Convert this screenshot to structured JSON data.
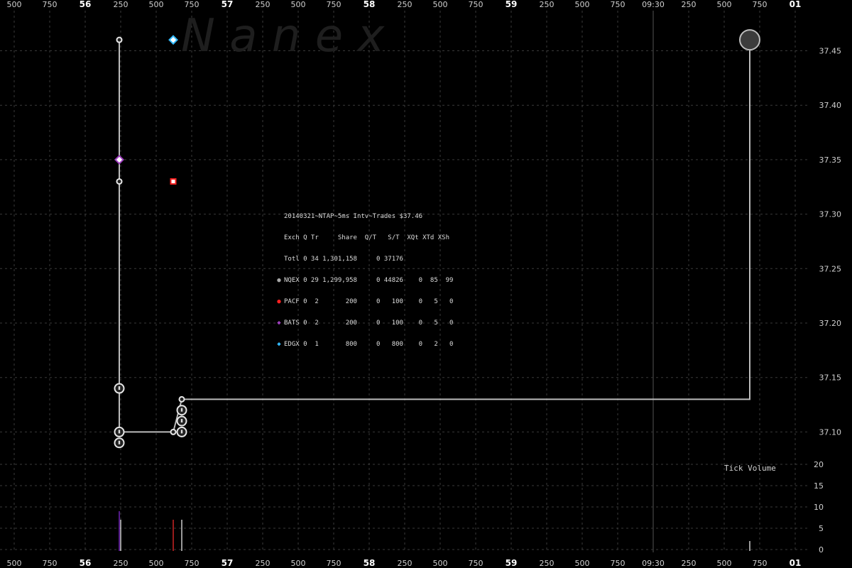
{
  "chart_data": {
    "type": "scatter",
    "title": "20140321~NTAP~5ms Intv~Trades $37.46",
    "watermark": "N a n e x",
    "volume_label": "Tick Volume",
    "price_axis": {
      "ticks": [
        "37.45",
        "37.40",
        "37.35",
        "37.30",
        "37.25",
        "37.20",
        "37.15",
        "37.10"
      ],
      "ylim": [
        37.085,
        37.475
      ]
    },
    "volume_axis": {
      "ticks": [
        "20",
        "15",
        "10",
        "5",
        "0"
      ],
      "ylim": [
        0,
        20
      ]
    },
    "time_axis": {
      "labels": [
        {
          "text": "500",
          "bold": false
        },
        {
          "text": "750",
          "bold": false
        },
        {
          "text": "56",
          "bold": true
        },
        {
          "text": "250",
          "bold": false
        },
        {
          "text": "500",
          "bold": false
        },
        {
          "text": "750",
          "bold": false
        },
        {
          "text": "57",
          "bold": true
        },
        {
          "text": "250",
          "bold": false
        },
        {
          "text": "500",
          "bold": false
        },
        {
          "text": "750",
          "bold": false
        },
        {
          "text": "58",
          "bold": true
        },
        {
          "text": "250",
          "bold": false
        },
        {
          "text": "500",
          "bold": false
        },
        {
          "text": "750",
          "bold": false
        },
        {
          "text": "59",
          "bold": true
        },
        {
          "text": "250",
          "bold": false
        },
        {
          "text": "500",
          "bold": false
        },
        {
          "text": "750",
          "bold": false
        },
        {
          "text": "09:30",
          "bold": false
        },
        {
          "text": "250",
          "bold": false
        },
        {
          "text": "500",
          "bold": false
        },
        {
          "text": "750",
          "bold": false
        },
        {
          "text": "01",
          "bold": true
        }
      ]
    },
    "price_line": {
      "name": "NQEX",
      "color": "#bbbbbb",
      "points": [
        {
          "t": 56.24,
          "p": 37.46
        },
        {
          "t": 56.24,
          "p": 37.1
        },
        {
          "t": 56.62,
          "p": 37.1
        },
        {
          "t": 56.68,
          "p": 37.13
        },
        {
          "t": 0.68,
          "p": 37.13
        },
        {
          "t": 0.68,
          "p": 37.46
        }
      ]
    },
    "trades": [
      {
        "exch": "NQEX",
        "t": 56.24,
        "p": 37.46,
        "size": "small"
      },
      {
        "exch": "NQEX",
        "t": 56.24,
        "p": 37.33,
        "size": "small"
      },
      {
        "exch": "NQEX",
        "t": 56.24,
        "p": 37.14,
        "size": "medium"
      },
      {
        "exch": "NQEX",
        "t": 56.24,
        "p": 37.1,
        "size": "medium"
      },
      {
        "exch": "NQEX",
        "t": 56.24,
        "p": 37.09,
        "size": "medium"
      },
      {
        "exch": "NQEX",
        "t": 56.62,
        "p": 37.1,
        "size": "small"
      },
      {
        "exch": "NQEX",
        "t": 56.68,
        "p": 37.1,
        "size": "medium"
      },
      {
        "exch": "NQEX",
        "t": 56.68,
        "p": 37.11,
        "size": "medium"
      },
      {
        "exch": "NQEX",
        "t": 56.68,
        "p": 37.12,
        "size": "medium"
      },
      {
        "exch": "NQEX",
        "t": 56.68,
        "p": 37.13,
        "size": "small"
      },
      {
        "exch": "NQEX",
        "t": 0.68,
        "p": 37.46,
        "size": "large"
      },
      {
        "exch": "BATS",
        "t": 56.24,
        "p": 37.35,
        "size": "small"
      },
      {
        "exch": "PACF",
        "t": 56.62,
        "p": 37.33,
        "size": "small"
      },
      {
        "exch": "EDGX",
        "t": 56.62,
        "p": 37.46,
        "size": "small"
      }
    ],
    "volume_bars": [
      {
        "t": 56.24,
        "v": 9,
        "color": "#8a2be2"
      },
      {
        "t": 56.25,
        "v": 7,
        "color": "#ffffff"
      },
      {
        "t": 56.62,
        "v": 7,
        "color": "#ff3030"
      },
      {
        "t": 56.68,
        "v": 7,
        "color": "#ffffff"
      },
      {
        "t": 0.68,
        "v": 2,
        "color": "#ffffff"
      }
    ],
    "colors": {
      "NQEX": "#a8a8a8",
      "PACF": "#ff2020",
      "BATS": "#a040c0",
      "EDGX": "#33bbff",
      "background": "#000000",
      "grid": "#3a3a3a"
    }
  },
  "legend": {
    "title": "20140321~NTAP~5ms Intv~Trades $37.46",
    "header": "Exch Q Tr     Share  Q/T   S/T  XQt XTd XSh",
    "rows": [
      {
        "sym": "",
        "color": "",
        "text": "Totl 0 34 1,301,158     0 37176"
      },
      {
        "sym": "●",
        "color": "#a8a8a8",
        "text": "NQEX 0 29 1,299,958     0 44826    0  85  99"
      },
      {
        "sym": "●",
        "color": "#ff2020",
        "text": "PACF 0  2       200     0   100    0   5   0"
      },
      {
        "sym": "◆",
        "color": "#a040c0",
        "text": "BATS 0  2       200     0   100    0   5   0"
      },
      {
        "sym": "◆",
        "color": "#33bbff",
        "text": "EDGX 0  1       800     0   800    0   2   0"
      }
    ]
  }
}
